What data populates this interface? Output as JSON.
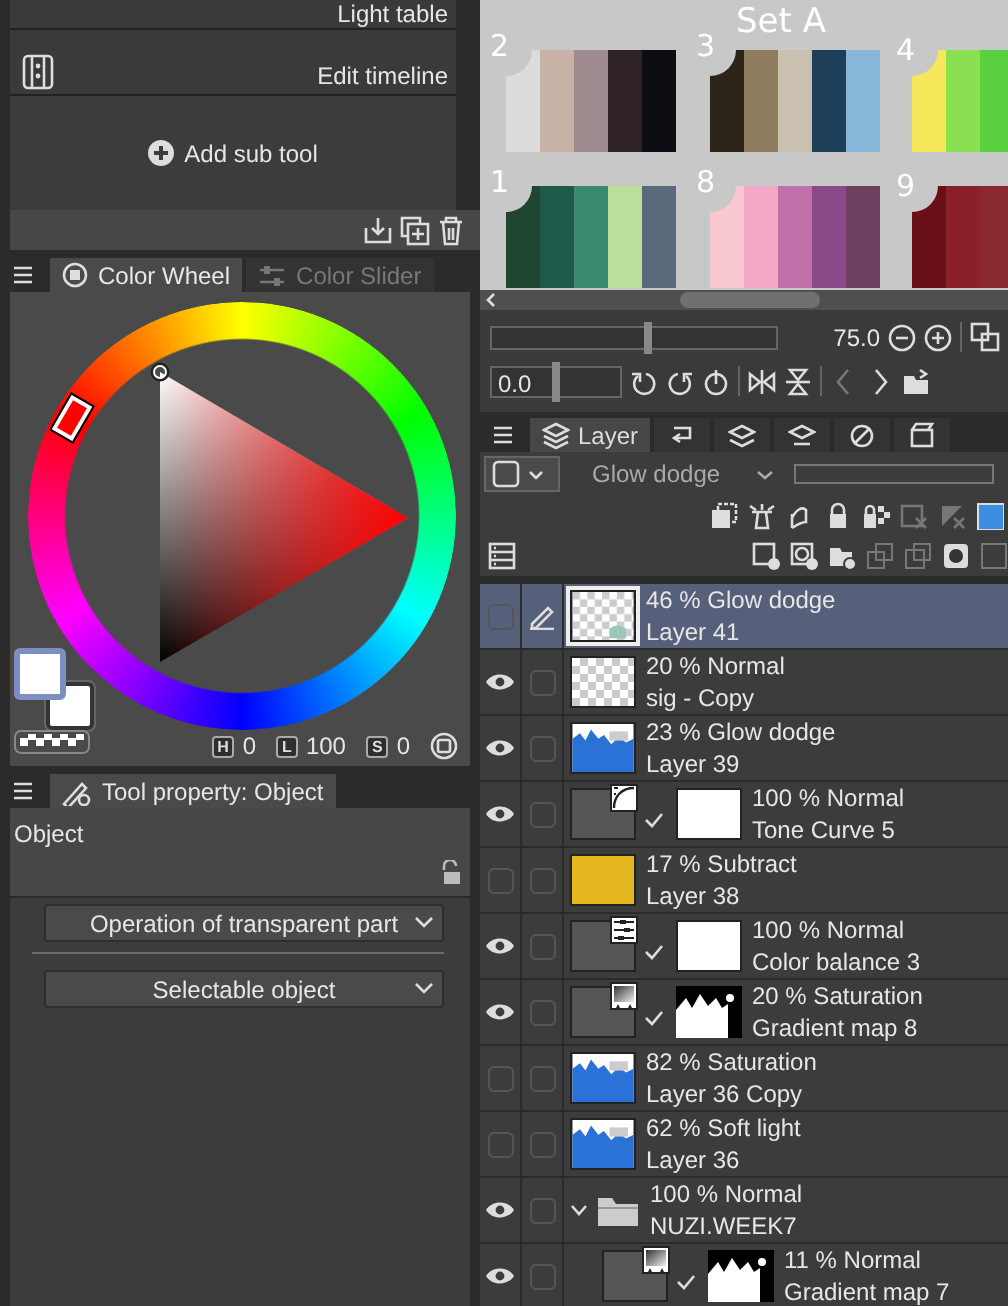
{
  "sub_tool": {
    "items": [
      {
        "label": "Light table",
        "selected": false
      },
      {
        "label": "Edit timeline",
        "selected": false
      }
    ],
    "add_button": "Add sub tool"
  },
  "color_panel": {
    "tabs": [
      {
        "label": "Color Wheel",
        "selected": true
      },
      {
        "label": "Color Slider",
        "selected": false
      }
    ],
    "readings": [
      {
        "label": "H",
        "value": "0"
      },
      {
        "label": "L",
        "value": "100"
      },
      {
        "label": "S",
        "value": "0"
      }
    ]
  },
  "tool_property": {
    "tab": "Tool property: Object",
    "section": "Object",
    "dropdowns": [
      "Operation of transparent part",
      "Selectable object"
    ]
  },
  "canvas": {
    "labels": [
      "Set A",
      "2",
      "3",
      "4",
      "1",
      "8",
      "9"
    ]
  },
  "navigator": {
    "zoom": "75.0",
    "zoom_slider": {
      "level": 0.55
    },
    "rotation": "0.0",
    "rotation_slider": {
      "level": 0.5
    }
  },
  "layer_panel": {
    "tabs": [
      {
        "label": "Layer",
        "selected": true
      },
      {
        "selected": false
      },
      {
        "selected": false
      },
      {
        "selected": false
      },
      {
        "selected": false
      },
      {
        "selected": false
      }
    ],
    "blend_mode": "Glow dodge",
    "opacity_slider": {
      "level": 0
    },
    "layers": [
      {
        "mode": "46 % Glow dodge",
        "name": "Layer 41",
        "kind": "raster",
        "thumbnail": {
          "kind": "sparse"
        },
        "visible": false,
        "selected": true
      },
      {
        "mode": "20 % Normal",
        "name": "sig - Copy",
        "kind": "raster",
        "thumbnail": {
          "kind": "blank"
        },
        "visible": true,
        "selected": false
      },
      {
        "mode": "23 % Glow dodge",
        "name": "Layer 39",
        "kind": "raster",
        "thumbnail": {
          "kind": "paint"
        },
        "visible": true,
        "selected": false
      },
      {
        "mode": "100 % Normal",
        "name": "Tone Curve 5",
        "kind": "tone_curve",
        "mask": {
          "kind": "full"
        },
        "visible": true,
        "selected": false
      },
      {
        "mode": "17 % Subtract",
        "name": "Layer 38",
        "kind": "raster",
        "thumbnail": {
          "kind": "fill"
        },
        "visible": false,
        "selected": false
      },
      {
        "mode": "100 % Normal",
        "name": "Color balance 3",
        "kind": "color_balance",
        "mask": {
          "kind": "full"
        },
        "visible": true,
        "selected": false
      },
      {
        "mode": "20 % Saturation",
        "name": "Gradient map 8",
        "kind": "gradient_map",
        "mask": {
          "kind": "partial"
        },
        "visible": true,
        "selected": false
      },
      {
        "mode": "82 % Saturation",
        "name": "Layer 36 Copy",
        "kind": "raster",
        "thumbnail": {
          "kind": "paint"
        },
        "visible": false,
        "selected": false
      },
      {
        "mode": "62 % Soft light",
        "name": "Layer 36",
        "kind": "raster",
        "thumbnail": {
          "kind": "paint"
        },
        "visible": false,
        "selected": false
      },
      {
        "mode": "100 % Normal",
        "name": "NUZI.WEEK7",
        "kind": "folder",
        "expanded": true,
        "visible": true,
        "selected": false,
        "children": [
          {
            "mode": "11 % Normal",
            "name": "Gradient map 7",
            "kind": "gradient_map",
            "mask": {
              "kind": "partial"
            },
            "visible": true,
            "selected": false
          }
        ]
      }
    ]
  }
}
